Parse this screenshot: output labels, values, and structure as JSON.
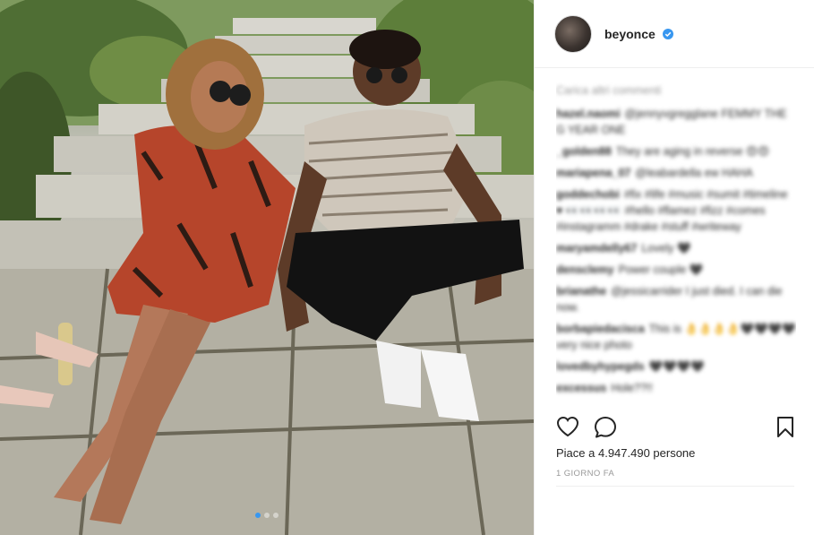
{
  "post": {
    "username": "beyonce",
    "verified": true,
    "likes_text": "Piace a 4.947.490 persone",
    "timestamp": "1 GIORNO FA",
    "carousel": {
      "count": 3,
      "active_index": 0
    }
  },
  "comments": {
    "load_more": "Carica altri commenti",
    "items": [
      {
        "user": "hazel.naomi",
        "text": "@jennyvgregglane FEMMY THE G YEAR ONE"
      },
      {
        "user": "_golden88",
        "text": "They are aging in reverse 😍😍"
      },
      {
        "user": "mariapena_07",
        "text": "@leabardella ew HAHA"
      },
      {
        "user": "goddechobi",
        "text": "#fix #life #music #sumit #timeline ♥ 👀👀👀👀 #hello #flamez #fizz #comes #instagramm #drake #stuff #writeway"
      },
      {
        "user": "maryamdelly67",
        "text": "Lovely 🖤"
      },
      {
        "user": "densclemy",
        "text": "Power couple 🖤"
      },
      {
        "user": "brianathe",
        "text": "@jessicarrider I just died. I can die now."
      },
      {
        "user": "borbapiedacisca",
        "text": "This is 👌👌👌👌🖤🖤🖤🖤 very nice photo"
      },
      {
        "user": "lovedbyhypegds",
        "text": "🖤🖤🖤🖤"
      },
      {
        "user": "excessus",
        "text": "Hole??!!"
      }
    ]
  },
  "icons": {
    "like": "heart-icon",
    "comment": "comment-icon",
    "save": "bookmark-icon",
    "verified": "verified-badge-icon"
  },
  "colors": {
    "accent": "#3897f0",
    "text": "#262626",
    "muted": "#999999",
    "border": "#efefef"
  }
}
